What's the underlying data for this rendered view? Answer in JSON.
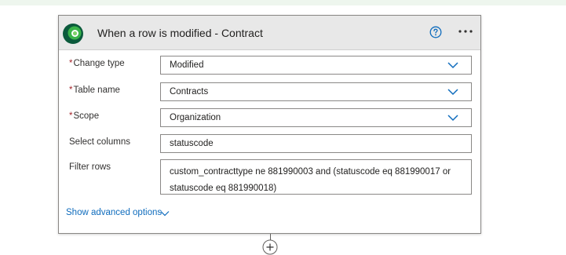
{
  "trigger": {
    "title": "When a row is modified - Contract",
    "icon": "dataverse-logo-icon",
    "help_icon": "help-circle-icon",
    "more_icon": "more-options-icon"
  },
  "fields": {
    "change_type": {
      "required_mark": "*",
      "label": "Change type",
      "value": "Modified"
    },
    "table_name": {
      "required_mark": "*",
      "label": "Table name",
      "value": "Contracts"
    },
    "scope": {
      "required_mark": "*",
      "label": "Scope",
      "value": "Organization"
    },
    "select_columns": {
      "label": "Select columns",
      "value": "statuscode"
    },
    "filter_rows": {
      "label": "Filter rows",
      "value": "custom_contracttype ne 881990003 and (statuscode eq 881990017 or statuscode eq 881990018)"
    }
  },
  "advanced": {
    "label": "Show advanced options"
  },
  "add_step": {
    "icon": "plus-icon"
  },
  "colors": {
    "accent": "#0f6cbd",
    "required": "#a4262c",
    "header_bg": "#e8e8e8",
    "logo_dark": "#0b5a3c",
    "logo_light": "#3ab44a"
  }
}
